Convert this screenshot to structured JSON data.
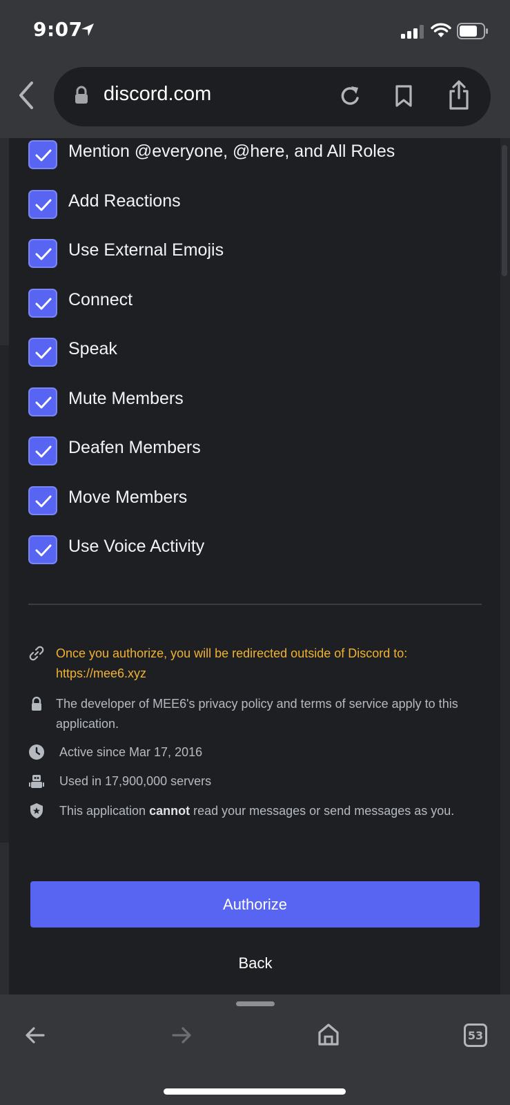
{
  "status_bar": {
    "time": "9:07",
    "icons": [
      "location-arrow-icon",
      "signal-icon",
      "wifi-icon",
      "battery-icon"
    ]
  },
  "browser": {
    "url": "discord.com",
    "tab_count": "53"
  },
  "permissions": [
    {
      "label": "Mention @everyone, @here, and All Roles",
      "checked": true
    },
    {
      "label": "Add Reactions",
      "checked": true
    },
    {
      "label": "Use External Emojis",
      "checked": true
    },
    {
      "label": "Connect",
      "checked": true
    },
    {
      "label": "Speak",
      "checked": true
    },
    {
      "label": "Mute Members",
      "checked": true
    },
    {
      "label": "Deafen Members",
      "checked": true
    },
    {
      "label": "Move Members",
      "checked": true
    },
    {
      "label": "Use Voice Activity",
      "checked": true
    }
  ],
  "info": {
    "redirect_line1": "Once you authorize, you will be redirected outside of Discord to:",
    "redirect_url": "https://mee6.xyz",
    "privacy": "The developer of MEE6's privacy policy and terms of service apply to this application.",
    "active_since": "Active since Mar 17, 2016",
    "used_in": "Used in 17,900,000 servers",
    "cannot_prefix": "This application ",
    "cannot_bold": "cannot",
    "cannot_suffix": " read your messages or send messages as you."
  },
  "actions": {
    "authorize": "Authorize",
    "back": "Back"
  },
  "colors": {
    "accent": "#5865f2",
    "warning": "#f0b232",
    "modal_bg": "#1e1f22"
  }
}
